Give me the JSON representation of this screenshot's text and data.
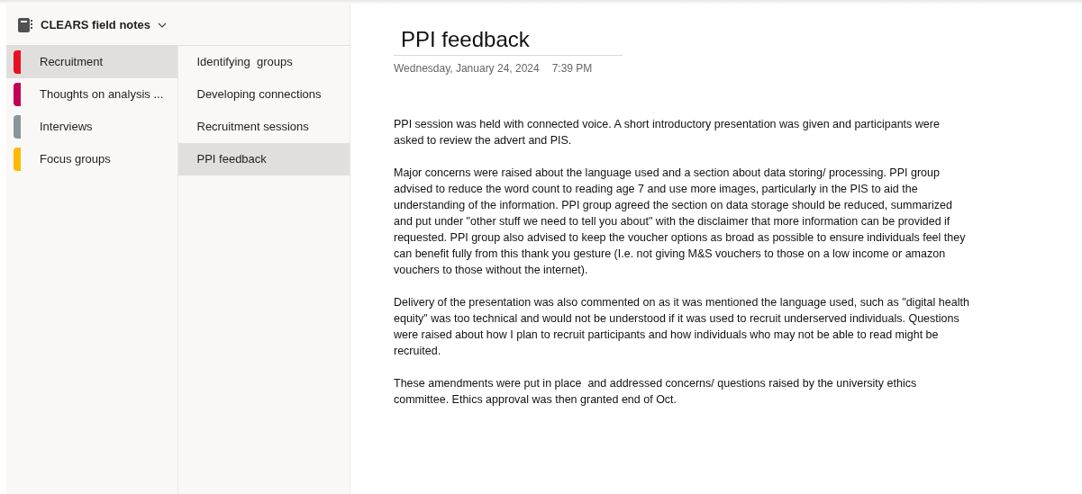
{
  "notebook": {
    "title": "CLEARS field notes"
  },
  "sections": [
    {
      "label": "Recruitment",
      "color": "#e81123",
      "selected": true
    },
    {
      "label": "Thoughts on analysis ...",
      "color": "#c30052",
      "selected": false
    },
    {
      "label": "Interviews",
      "color": "#8a969c",
      "selected": false
    },
    {
      "label": "Focus groups",
      "color": "#ffb900",
      "selected": false
    }
  ],
  "pages": [
    {
      "label": "Identifying  groups",
      "selected": false
    },
    {
      "label": "Developing connections",
      "selected": false
    },
    {
      "label": "Recruitment sessions",
      "selected": false
    },
    {
      "label": "PPI feedback",
      "selected": true
    }
  ],
  "page": {
    "title": "PPI feedback",
    "date": "Wednesday, January 24, 2024",
    "time": "7:39 PM",
    "paragraphs": [
      "PPI session was held with connected voice. A short introductory presentation was given and participants were asked to review the advert and PIS.",
      "Major concerns were raised about the language used and a section about data storing/ processing. PPI group advised to reduce the word count to reading age 7 and use more images, particularly in the PIS to aid the understanding of the information. PPI group agreed the section on data storage should be reduced, summarized and put under \"other stuff we need to tell you about\" with the disclaimer that more information can be provided if requested. PPI group also advised to keep the voucher options as broad as possible to ensure individuals feel they can benefit fully from this thank you gesture (I.e. not giving M&S vouchers to those on a low income or amazon vouchers to those without the internet).",
      "Delivery of the presentation was also commented on as it was mentioned the language used, such as \"digital health equity\" was too technical and would not be understood if it was used to recruit underserved individuals. Questions were raised about how I plan to recruit participants and how individuals who may not be able to read might be recruited.",
      "These amendments were put in place  and addressed concerns/ questions raised by the university ethics committee. Ethics approval was then granted end of Oct."
    ]
  }
}
